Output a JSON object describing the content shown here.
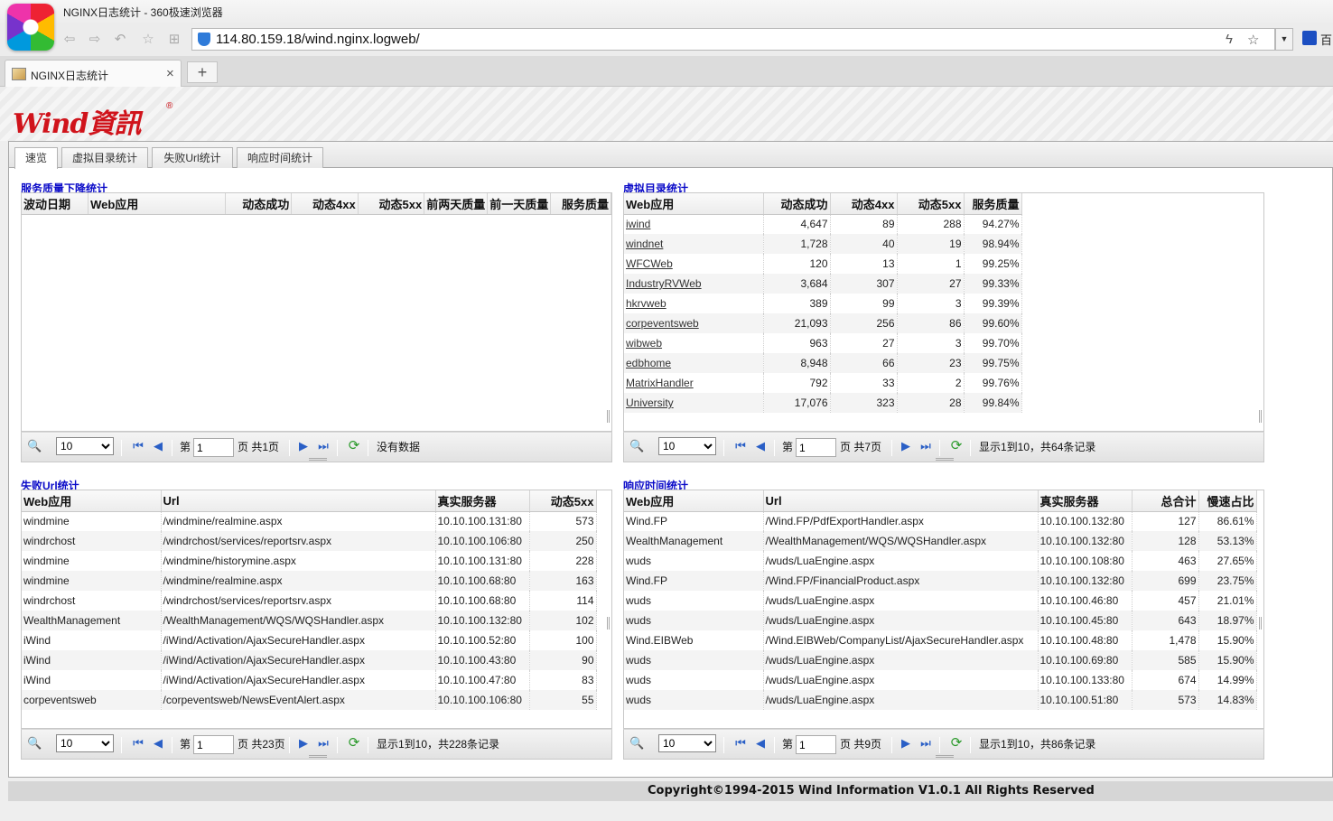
{
  "browser": {
    "window_title": "NGINX日志统计 - 360极速浏览器",
    "url": "114.80.159.18/wind.nginx.logweb/",
    "tab_title": "NGINX日志统计",
    "tab_close": "×",
    "new_tab": "+",
    "ext_label": "百"
  },
  "header": {
    "logo_text": "Wind資訊",
    "logo_mark": "®"
  },
  "page_tabs": [
    "速览",
    "虚拟目录统计",
    "失败Url统计",
    "响应时间统计"
  ],
  "panel1": {
    "title": "服务质量下降统计",
    "columns": [
      "波动日期",
      "Web应用",
      "动态成功",
      "动态4xx",
      "动态5xx",
      "前两天质量",
      "前一天质量",
      "服务质量"
    ],
    "rows": [],
    "pager": {
      "page_size": "10",
      "page_prefix": "第",
      "page": "1",
      "page_suffix": "页 共1页",
      "status": "没有数据"
    }
  },
  "panel2": {
    "title": "虚拟目录统计",
    "columns": [
      "Web应用",
      "动态成功",
      "动态4xx",
      "动态5xx",
      "服务质量"
    ],
    "rows": [
      [
        "iwind",
        "4,647",
        "89",
        "288",
        "94.27%"
      ],
      [
        "windnet",
        "1,728",
        "40",
        "19",
        "98.94%"
      ],
      [
        "WFCWeb",
        "120",
        "13",
        "1",
        "99.25%"
      ],
      [
        "IndustryRVWeb",
        "3,684",
        "307",
        "27",
        "99.33%"
      ],
      [
        "hkrvweb",
        "389",
        "99",
        "3",
        "99.39%"
      ],
      [
        "corpeventsweb",
        "21,093",
        "256",
        "86",
        "99.60%"
      ],
      [
        "wibweb",
        "963",
        "27",
        "3",
        "99.70%"
      ],
      [
        "edbhome",
        "8,948",
        "66",
        "23",
        "99.75%"
      ],
      [
        "MatrixHandler",
        "792",
        "33",
        "2",
        "99.76%"
      ],
      [
        "University",
        "17,076",
        "323",
        "28",
        "99.84%"
      ]
    ],
    "pager": {
      "page_size": "10",
      "page_prefix": "第",
      "page": "1",
      "page_suffix": "页 共7页",
      "status": "显示1到10，共64条记录"
    }
  },
  "panel3": {
    "title": "失败Url统计",
    "columns": [
      "Web应用",
      "Url",
      "真实服务器",
      "动态5xx"
    ],
    "rows": [
      [
        "windmine",
        "/windmine/realmine.aspx",
        "10.10.100.131:80",
        "573"
      ],
      [
        "windrchost",
        "/windrchost/services/reportsrv.aspx",
        "10.10.100.106:80",
        "250"
      ],
      [
        "windmine",
        "/windmine/historymine.aspx",
        "10.10.100.131:80",
        "228"
      ],
      [
        "windmine",
        "/windmine/realmine.aspx",
        "10.10.100.68:80",
        "163"
      ],
      [
        "windrchost",
        "/windrchost/services/reportsrv.aspx",
        "10.10.100.68:80",
        "114"
      ],
      [
        "WealthManagement",
        "/WealthManagement/WQS/WQSHandler.aspx",
        "10.10.100.132:80",
        "102"
      ],
      [
        "iWind",
        "/iWind/Activation/AjaxSecureHandler.aspx",
        "10.10.100.52:80",
        "100"
      ],
      [
        "iWind",
        "/iWind/Activation/AjaxSecureHandler.aspx",
        "10.10.100.43:80",
        "90"
      ],
      [
        "iWind",
        "/iWind/Activation/AjaxSecureHandler.aspx",
        "10.10.100.47:80",
        "83"
      ],
      [
        "corpeventsweb",
        "/corpeventsweb/NewsEventAlert.aspx",
        "10.10.100.106:80",
        "55"
      ]
    ],
    "pager": {
      "page_size": "10",
      "page_prefix": "第",
      "page": "1",
      "page_suffix": "页 共23页",
      "status": "显示1到10，共228条记录"
    }
  },
  "panel4": {
    "title": "响应时间统计",
    "columns": [
      "Web应用",
      "Url",
      "真实服务器",
      "总合计",
      "慢速占比"
    ],
    "rows": [
      [
        "Wind.FP",
        "/Wind.FP/PdfExportHandler.aspx",
        "10.10.100.132:80",
        "127",
        "86.61%"
      ],
      [
        "WealthManagement",
        "/WealthManagement/WQS/WQSHandler.aspx",
        "10.10.100.132:80",
        "128",
        "53.13%"
      ],
      [
        "wuds",
        "/wuds/LuaEngine.aspx",
        "10.10.100.108:80",
        "463",
        "27.65%"
      ],
      [
        "Wind.FP",
        "/Wind.FP/FinancialProduct.aspx",
        "10.10.100.132:80",
        "699",
        "23.75%"
      ],
      [
        "wuds",
        "/wuds/LuaEngine.aspx",
        "10.10.100.46:80",
        "457",
        "21.01%"
      ],
      [
        "wuds",
        "/wuds/LuaEngine.aspx",
        "10.10.100.45:80",
        "643",
        "18.97%"
      ],
      [
        "Wind.EIBWeb",
        "/Wind.EIBWeb/CompanyList/AjaxSecureHandler.aspx",
        "10.10.100.48:80",
        "1,478",
        "15.90%"
      ],
      [
        "wuds",
        "/wuds/LuaEngine.aspx",
        "10.10.100.69:80",
        "585",
        "15.90%"
      ],
      [
        "wuds",
        "/wuds/LuaEngine.aspx",
        "10.10.100.133:80",
        "674",
        "14.99%"
      ],
      [
        "wuds",
        "/wuds/LuaEngine.aspx",
        "10.10.100.51:80",
        "573",
        "14.83%"
      ]
    ],
    "pager": {
      "page_size": "10",
      "page_prefix": "第",
      "page": "1",
      "page_suffix": "页 共9页",
      "status": "显示1到10，共86条记录"
    }
  },
  "footer": {
    "copyright": "Copyright©1994-2015 Wind Information V1.0.1 All Rights Reserved"
  }
}
